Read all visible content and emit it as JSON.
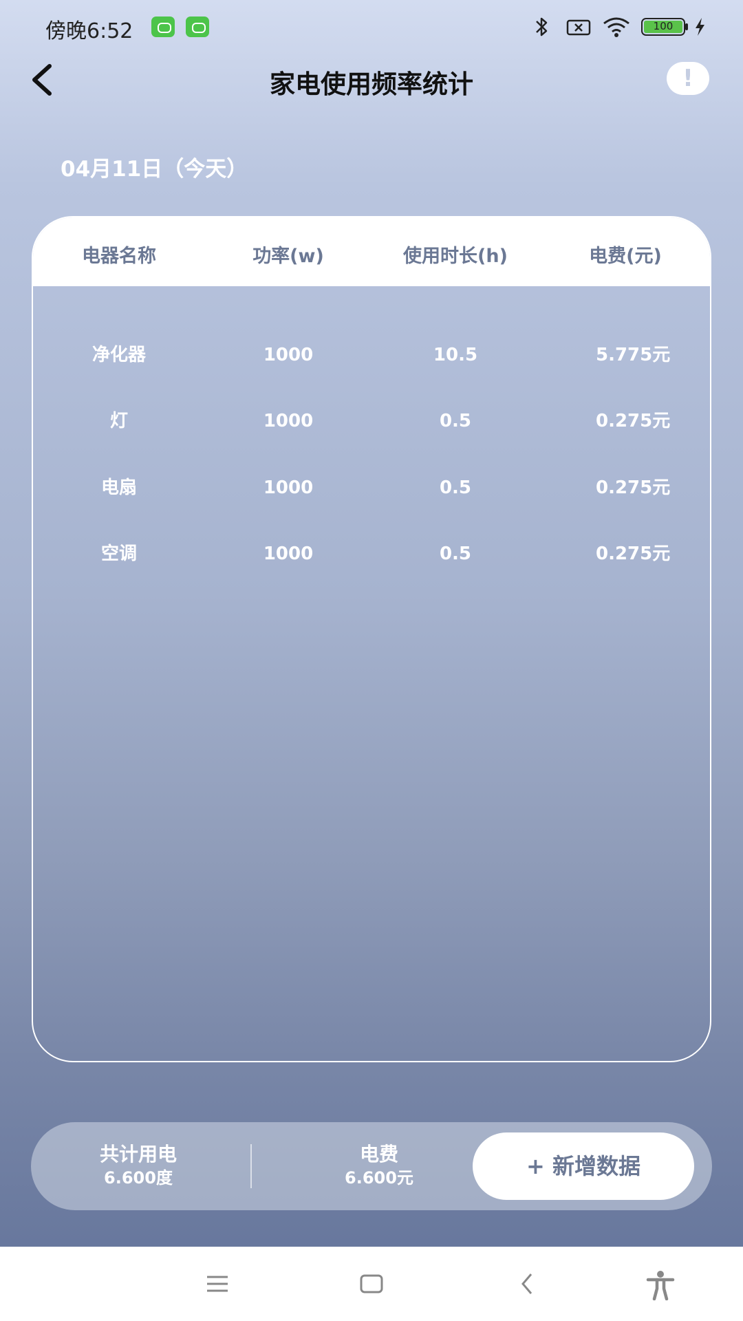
{
  "status_bar": {
    "time": "傍晚6:52",
    "battery": "100"
  },
  "header": {
    "title": "家电使用频率统计",
    "info_glyph": "!"
  },
  "date_label": "04月11日（今天）",
  "table": {
    "headers": [
      "电器名称",
      "功率(w)",
      "使用时长(h)",
      "电费(元)"
    ],
    "rows": [
      {
        "name": "净化器",
        "power": "1000",
        "hours": "10.5",
        "cost": "5.775元"
      },
      {
        "name": "灯",
        "power": "1000",
        "hours": "0.5",
        "cost": "0.275元"
      },
      {
        "name": "电扇",
        "power": "1000",
        "hours": "0.5",
        "cost": "0.275元"
      },
      {
        "name": "空调",
        "power": "1000",
        "hours": "0.5",
        "cost": "0.275元"
      }
    ]
  },
  "summary": {
    "total_label": "共计用电",
    "total_value": "6.600度",
    "cost_label": "电费",
    "cost_value": "6.600元",
    "add_button": "+ 新增数据"
  },
  "icons": {
    "back": "chevron-left-icon",
    "info": "exclamation-icon",
    "nav_menu": "menu-icon",
    "nav_home": "square-icon",
    "nav_back": "chevron-left-icon",
    "nav_accessibility": "accessibility-icon"
  },
  "colors": {
    "header_text": "#6b7894",
    "app_badge": "#4cc44a"
  }
}
